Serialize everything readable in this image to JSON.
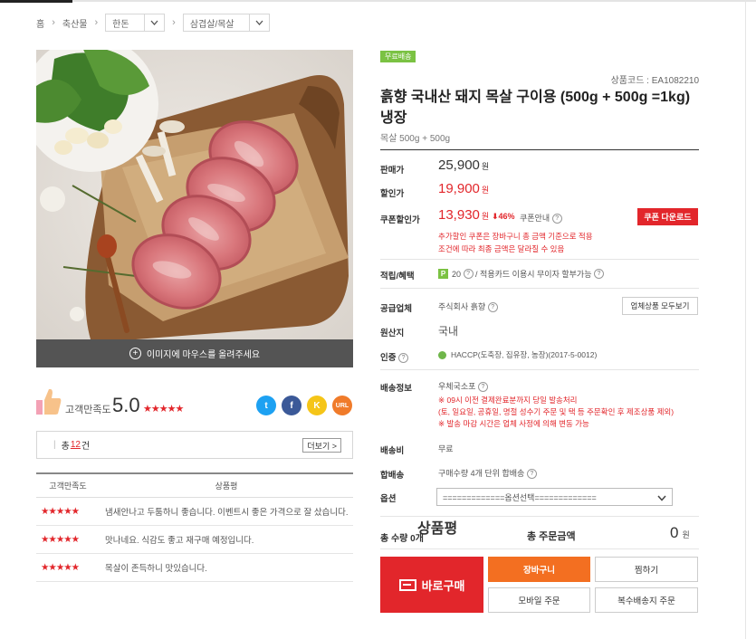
{
  "breadcrumb": {
    "home": "홈",
    "level1": "축산물",
    "level2": "한돈",
    "level3": "삼겹살/목살"
  },
  "image": {
    "hint": "이미지에 마우스를 올려주세요"
  },
  "satisfaction": {
    "label": "고객만족도",
    "score": "5.0",
    "stars": "★★★★★",
    "share": {
      "twitter": "t",
      "facebook": "f",
      "kakaostory": "K",
      "url": "URL"
    }
  },
  "reviews": {
    "title": "상품평",
    "count_prefix": "총",
    "count": "12",
    "count_suffix": "건",
    "more": "더보기 >",
    "col_rating": "고객만족도",
    "col_review": "상품평",
    "rows": [
      {
        "stars": "★★★★★",
        "text": "냄새안나고 두툼하니 좋습니다. 이벤트시 좋은 가격으로 잘 샀습니다."
      },
      {
        "stars": "★★★★★",
        "text": "맛나네요. 식감도 좋고 재구매 예정입니다."
      },
      {
        "stars": "★★★★★",
        "text": "목살이 존득하니 맛있습니다."
      }
    ]
  },
  "product": {
    "badge": "무료배송",
    "code": "상품코드 : EA1082210",
    "title": "흙향 국내산 돼지 목살 구이용 (500g + 500g =1kg) 냉장",
    "subtitle": "목살 500g + 500g"
  },
  "price": {
    "regular_label": "판매가",
    "regular": "25,900",
    "sale_label": "할인가",
    "sale": "19,900",
    "coupon_label": "쿠폰할인가",
    "coupon": "13,930",
    "discount": "⬇46%",
    "coupon_info": "쿠폰안내",
    "coupon_btn": "쿠폰 다운로드",
    "won": "원",
    "note1": "추가할인 쿠폰은 장바구니 총 금액 기준으로 적용",
    "note2": "조건에 따라 최종 금액은 달라질 수 있음"
  },
  "info": {
    "points_label": "적립/혜택",
    "points": "20",
    "points_rest": "/ 적용카드 이용시 무이자 할부가능",
    "supplier_label": "공급업체",
    "supplier": "주식회사 흙향",
    "supplier_btn": "업체상품 모두보기",
    "origin_label": "원산지",
    "origin": "국내",
    "cert_label": "인증",
    "cert": "HACCP(도축장, 집유장, 농장)(2017-5-0012)",
    "delivery_label": "배송정보",
    "delivery": "우체국소포",
    "delivery_note1": "※ 09시 이전 결제완료분까지 당일 발송처리",
    "delivery_note2": "(토, 일요일, 공휴일, 명절 성수기 주문 및 택 등 주문확인 후 제조상품 제외)",
    "delivery_note3": "※ 발송 마감 시간은 업체 사정에 의해 변동 가능",
    "ship_fee_label": "배송비",
    "ship_fee": "무료",
    "combined_label": "합배송",
    "combined": "구매수량 4개 단위 합배송",
    "option_label": "옵션",
    "option": "=============옵션선택============="
  },
  "order": {
    "qty": "총 수량 0개",
    "total_label": "총 주문금액",
    "total": "0",
    "won": "원",
    "buy": "바로구매",
    "cart": "장바구니",
    "wish": "찜하기",
    "mobile": "모바일 주문",
    "multi": "복수배송지 주문"
  }
}
